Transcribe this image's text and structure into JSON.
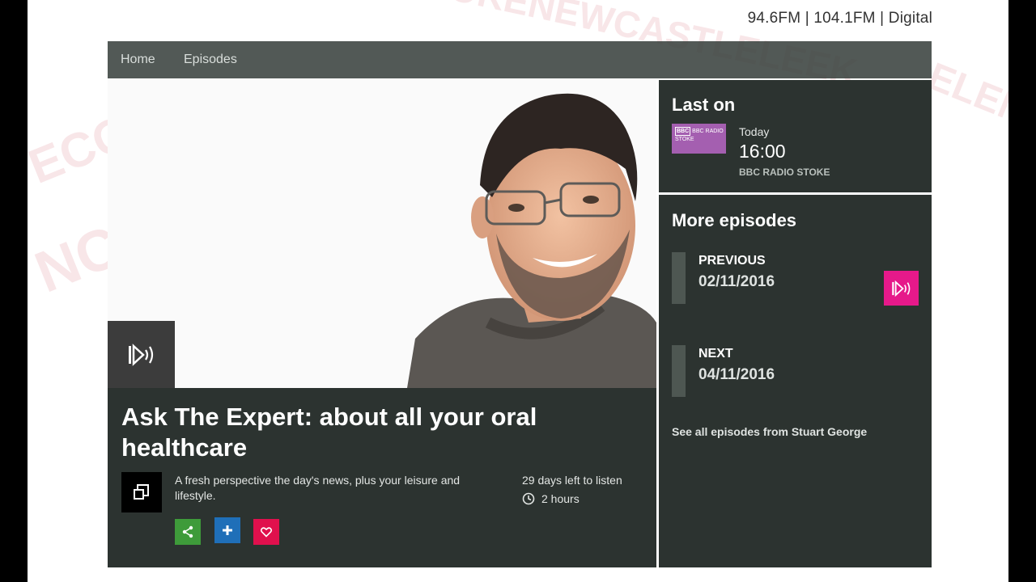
{
  "header": {
    "frequencies": "94.6FM | 104.1FM | Digital"
  },
  "nav": {
    "items": [
      {
        "label": "Home"
      },
      {
        "label": "Episodes"
      }
    ]
  },
  "episode": {
    "title": "Ask The Expert: about all your oral healthcare",
    "description": "A fresh perspective the day's news, plus your leisure and lifestyle.",
    "days_left": "29 days left to listen",
    "duration": "2 hours"
  },
  "last_on": {
    "heading": "Last on",
    "station_logo_text": "BBC RADIO STOKE",
    "day": "Today",
    "time": "16:00",
    "station": "BBC RADIO STOKE"
  },
  "more_episodes": {
    "heading": "More episodes",
    "previous_label": "PREVIOUS",
    "previous_date": "02/11/2016",
    "next_label": "NEXT",
    "next_date": "04/11/2016",
    "see_all": "See all episodes from Stuart George"
  },
  "icons": {
    "play": "play-icon",
    "popout": "popout-icon",
    "clock": "clock-icon",
    "share": "share-icon",
    "add": "plus-icon",
    "favourite": "heart-icon"
  },
  "colors": {
    "panel": "#2c3330",
    "nav": "#363e3a",
    "share_btn": "#3e9b3a",
    "add_btn": "#1f6fb8",
    "favourite_btn": "#e0104d",
    "play_accent": "#e6198a",
    "station_logo": "#a45fb0"
  }
}
